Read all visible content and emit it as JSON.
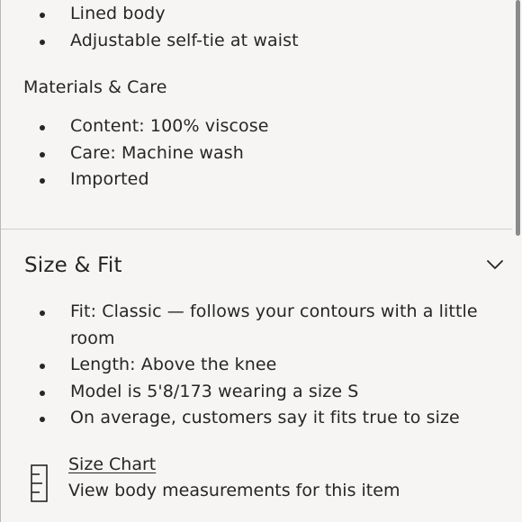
{
  "details": {
    "bullets": [
      "Lined body",
      "Adjustable self-tie at waist"
    ]
  },
  "materials": {
    "heading": "Materials & Care",
    "bullets": [
      "Content: 100% viscose",
      "Care: Machine wash",
      "Imported"
    ]
  },
  "size_fit": {
    "title": "Size & Fit",
    "toggle_icon": "chevron-down-icon",
    "bullets": [
      "Fit: Classic — follows your contours with a little room",
      "Length: Above the knee",
      "Model is 5'8/173 wearing a size S",
      "On average, customers say it fits true to size"
    ],
    "size_chart": {
      "icon": "ruler-icon",
      "link_label": "Size Chart",
      "description": "View body measurements for this item"
    }
  },
  "colors": {
    "background": "#f6f5f3",
    "text": "#262626",
    "divider": "#cfcfcf"
  }
}
